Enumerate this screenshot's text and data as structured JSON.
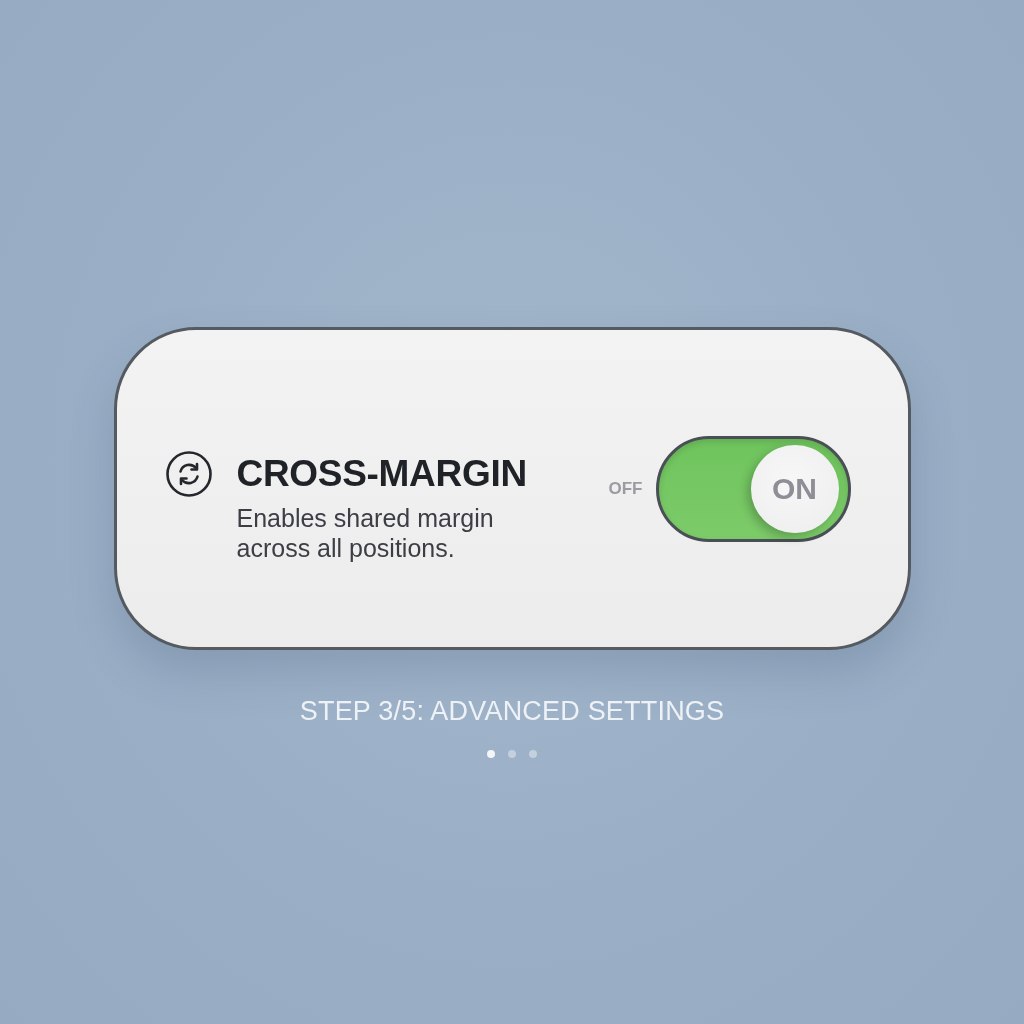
{
  "card": {
    "title": "CROSS-MARGIN",
    "description": "Enables shared margin across all positions.",
    "switch": {
      "off_label": "OFF",
      "on": true,
      "knob_label": "ON"
    }
  },
  "step": {
    "label": "STEP 3/5: ADVANCED SETTINGS",
    "dots": [
      {
        "selected": true
      },
      {
        "selected": false
      },
      {
        "selected": false
      }
    ]
  }
}
